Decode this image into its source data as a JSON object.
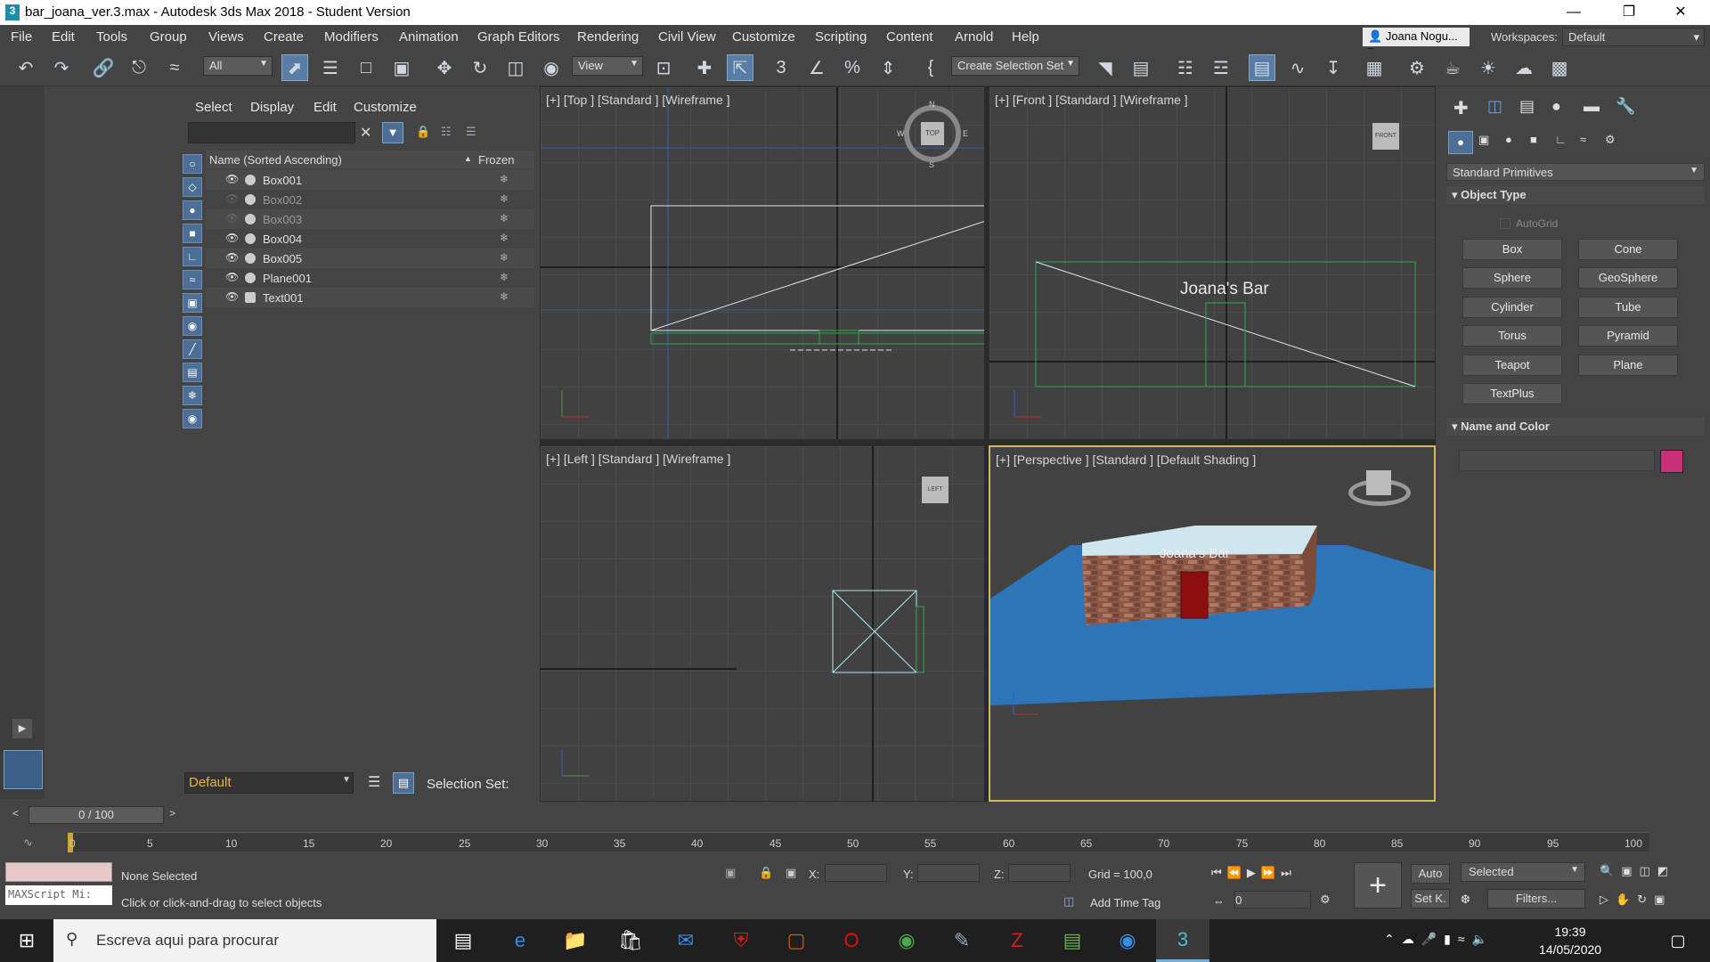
{
  "window": {
    "title": "bar_joana_ver.3.max - Autodesk 3ds Max 2018 - Student Version",
    "icon_label": "3"
  },
  "menubar": [
    "File",
    "Edit",
    "Tools",
    "Group",
    "Views",
    "Create",
    "Modifiers",
    "Animation",
    "Graph Editors",
    "Rendering",
    "Civil View",
    "Customize",
    "Scripting",
    "Content",
    "Arnold",
    "Help"
  ],
  "user": {
    "name": "Joana Nogu...",
    "workspaces_label": "Workspaces:",
    "workspace": "Default"
  },
  "toolbar": {
    "filter": "All",
    "ref_coord": "View",
    "selection_set": "Create Selection Set"
  },
  "scene_explorer": {
    "tabs": [
      "Select",
      "Display",
      "Edit",
      "Customize"
    ],
    "header_name": "Name (Sorted Ascending)",
    "header_sort": "▲",
    "header_frozen": "Frozen",
    "rows": [
      {
        "name": "Box001",
        "visible": true
      },
      {
        "name": "Box002",
        "visible": false
      },
      {
        "name": "Box003",
        "visible": false
      },
      {
        "name": "Box004",
        "visible": true
      },
      {
        "name": "Box005",
        "visible": true
      },
      {
        "name": "Plane001",
        "visible": true
      },
      {
        "name": "Text001",
        "visible": true
      }
    ],
    "layer": "Default",
    "selection_set_label": "Selection Set:"
  },
  "viewports": {
    "top": "[+] [Top ] [Standard ] [Wireframe ]",
    "front": "[+] [Front ] [Standard ] [Wireframe ]",
    "left": "[+] [Left ] [Standard ] [Wireframe ]",
    "perspective": "[+] [Perspective ] [Standard ] [Default Shading ]",
    "sign_text": "Joana's Bar",
    "viewcube_top": "TOP",
    "viewcube_front": "FRONT",
    "viewcube_left": "LEFT",
    "compass": [
      "N",
      "E",
      "S",
      "W"
    ]
  },
  "command_panel": {
    "category": "Standard Primitives",
    "object_type_title": "Object Type",
    "autogrid": "AutoGrid",
    "buttons": [
      "Box",
      "Cone",
      "Sphere",
      "GeoSphere",
      "Cylinder",
      "Tube",
      "Torus",
      "Pyramid",
      "Teapot",
      "Plane",
      "TextPlus"
    ],
    "name_color_title": "Name and Color",
    "color": "#c8307a"
  },
  "timeline": {
    "frame": "0 / 100",
    "ticks": [
      "0",
      "5",
      "10",
      "15",
      "20",
      "25",
      "30",
      "35",
      "40",
      "45",
      "50",
      "55",
      "60",
      "65",
      "70",
      "75",
      "80",
      "85",
      "90",
      "95",
      "100"
    ]
  },
  "status": {
    "selection": "None Selected",
    "prompt": "Click or click-and-drag to select objects",
    "maxscript": "MAXScript Mi:",
    "x_label": "X:",
    "y_label": "Y:",
    "z_label": "Z:",
    "grid": "Grid = 100,0",
    "add_time_tag": "Add Time Tag",
    "auto": "Auto",
    "set_key": "Set K.",
    "key_mode": "Selected",
    "filters": "Filters...",
    "current_frame": "0"
  },
  "taskbar": {
    "search_placeholder": "Escreva aqui para procurar",
    "time": "19:39",
    "date": "14/05/2020"
  }
}
